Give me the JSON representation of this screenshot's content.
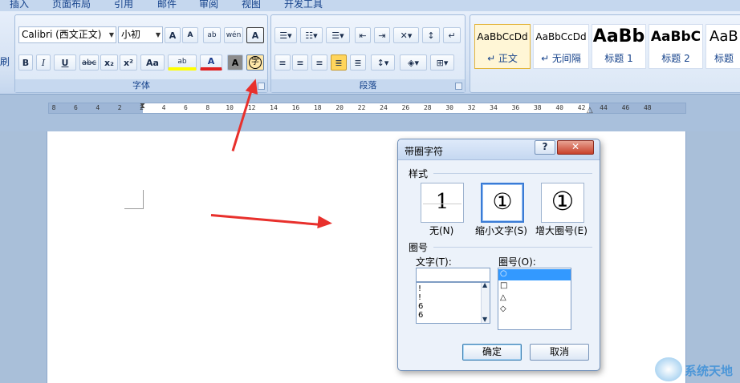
{
  "ribbon_tabs": [
    "插入",
    "页面布局",
    "引用",
    "邮件",
    "审阅",
    "视图",
    "开发工具"
  ],
  "left_edge_label": "刷",
  "font_group": {
    "label": "字体",
    "font_name": "Calibri (西文正文)",
    "font_size": "小初",
    "grow_font": "A",
    "shrink_font": "A",
    "clear_format": "ab",
    "pinyin": "wén",
    "char_border": "A",
    "bold": "B",
    "italic": "I",
    "underline": "U",
    "strike": "abc",
    "subscript": "x₂",
    "superscript": "x²",
    "change_case": "Aa",
    "highlight": "ab",
    "font_color": "A",
    "char_shading": "A",
    "enclose_char": "字"
  },
  "paragraph_group": {
    "label": "段落"
  },
  "styles": [
    {
      "sample": "AaBbCcDd",
      "name": "↵ 正文"
    },
    {
      "sample": "AaBbCcDd",
      "name": "↵ 无间隔"
    },
    {
      "sample": "AaBb",
      "name": "标题 1"
    },
    {
      "sample": "AaBbC",
      "name": "标题 2"
    },
    {
      "sample": "AaB",
      "name": "标题"
    }
  ],
  "ruler_ticks": [
    "8",
    "6",
    "4",
    "2",
    "2",
    "4",
    "6",
    "8",
    "10",
    "12",
    "14",
    "16",
    "18",
    "20",
    "22",
    "24",
    "26",
    "28",
    "30",
    "32",
    "34",
    "36",
    "38",
    "40",
    "42",
    "44",
    "46",
    "48"
  ],
  "dialog": {
    "title": "带圈字符",
    "help": "?",
    "close": "✕",
    "style_section": "样式",
    "options": [
      {
        "label": "无(N)",
        "glyph": "1"
      },
      {
        "label": "缩小文字(S)",
        "glyph": "①"
      },
      {
        "label": "增大圈号(E)",
        "glyph": "①"
      }
    ],
    "enclosure_section": "圈号",
    "text_label": "文字(T):",
    "text_value": "",
    "text_list": [
      "!",
      "!",
      "6",
      "6"
    ],
    "enclosure_label": "圈号(O):",
    "enclosure_list": [
      "○",
      "□",
      "△",
      "◇"
    ],
    "ok": "确定",
    "cancel": "取消"
  },
  "watermark": "系统天地"
}
